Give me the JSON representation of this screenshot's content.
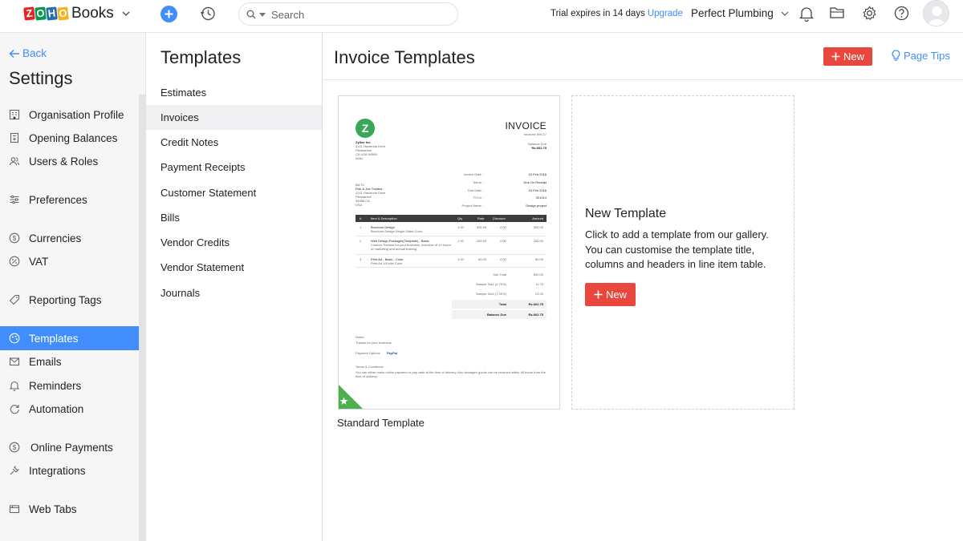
{
  "header": {
    "brand_letters": [
      "Z",
      "O",
      "H",
      "O"
    ],
    "brand_letter_colors": [
      "#e42527",
      "#089949",
      "#226db4",
      "#f9b21d"
    ],
    "brand_name": "Books",
    "search_placeholder": "Search",
    "trial_text": "Trial expires in 14 days",
    "upgrade_label": "Upgrade",
    "org_name": "Perfect Plumbing",
    "icons": [
      "add-icon",
      "history-icon",
      "search-icon",
      "bell-icon",
      "folder-icon",
      "gear-icon",
      "help-icon",
      "avatar"
    ]
  },
  "sidebar": {
    "back_label": "Back",
    "title": "Settings",
    "items": [
      {
        "label": "Organisation Profile",
        "icon": "organisation-icon"
      },
      {
        "label": "Opening Balances",
        "icon": "balances-icon"
      },
      {
        "label": "Users & Roles",
        "icon": "users-icon"
      },
      {
        "label": "Preferences",
        "icon": "preferences-icon"
      },
      {
        "label": "Currencies",
        "icon": "currency-icon"
      },
      {
        "label": "VAT",
        "icon": "percent-icon"
      },
      {
        "label": "Reporting Tags",
        "icon": "tag-icon"
      },
      {
        "label": "Templates",
        "icon": "templates-icon",
        "active": true
      },
      {
        "label": "Emails",
        "icon": "email-icon"
      },
      {
        "label": "Reminders",
        "icon": "bell-icon"
      },
      {
        "label": "Automation",
        "icon": "automation-icon"
      },
      {
        "label": "Online Payments",
        "icon": "payments-icon"
      },
      {
        "label": "Integrations",
        "icon": "integrations-icon"
      },
      {
        "label": "Web Tabs",
        "icon": "web-tabs-icon"
      }
    ]
  },
  "templates_menu": {
    "title": "Templates",
    "items": [
      {
        "label": "Estimates"
      },
      {
        "label": "Invoices",
        "active": true
      },
      {
        "label": "Credit Notes"
      },
      {
        "label": "Payment Receipts"
      },
      {
        "label": "Customer Statement"
      },
      {
        "label": "Bills"
      },
      {
        "label": "Vendor Credits"
      },
      {
        "label": "Vendor Statement"
      },
      {
        "label": "Journals"
      }
    ]
  },
  "main": {
    "title": "Invoice Templates",
    "new_label": "New",
    "page_tips_label": "Page Tips",
    "accent_color": "#408dfb",
    "danger_color": "#e9473e",
    "standard_template": {
      "label": "Standard Template",
      "preview": {
        "doc_title": "INVOICE",
        "invoice_no": "Invoice# INV-17",
        "balance_due_label": "Balance Due",
        "balance_due_value": "Rs.662.75",
        "company_lines": [
          "Zylker Inc",
          "4141 Hacienda Drive",
          "Pleasanton",
          "CA USA 94588",
          "India"
        ],
        "meta": [
          {
            "k": "Invoice Date :",
            "v": "15 Feb 2016"
          },
          {
            "k": "Terms :",
            "v": "Due On Receipt"
          },
          {
            "k": "Due Date :",
            "v": "15 Feb 2016"
          },
          {
            "k": "P.O.# :",
            "v": "321014"
          },
          {
            "k": "Project Name :",
            "v": "Design project"
          }
        ],
        "bill_to": [
          "Bill To",
          "Rob & Joe Traders",
          "4141 Hacienda Drive",
          "Pleasanton",
          "94588 CA",
          "USA"
        ],
        "columns": [
          "#",
          "Item & Description",
          "Qty",
          "Rate",
          "Discount",
          "Amount"
        ],
        "rows": [
          {
            "n": "1",
            "item": "Brochure Design",
            "desc": "Brochure Design Single Sided Color",
            "qty": "1.00",
            "rate": "300.00",
            "disc": "0.00",
            "amt": "300.00"
          },
          {
            "n": "2",
            "item": "Web Design Packages(Template) - Basic",
            "desc": "Custom Themes for your business. Inclusive of 10 hours of marketing and annual training",
            "qty": "1.00",
            "rate": "250.00",
            "disc": "0.00",
            "amt": "250.00"
          },
          {
            "n": "3",
            "item": "Print Ad - Basic - Color",
            "desc": "Print Ad 1/8 size Color",
            "qty": "1.00",
            "rate": "80.00",
            "disc": "0.00",
            "amt": "80.00"
          }
        ],
        "totals": [
          {
            "k": "Sub Total",
            "v": "630.00"
          },
          {
            "k": "Sample Tax1 (4.70%)",
            "v": "11.75"
          },
          {
            "k": "Sample Tax2 (7.00%)",
            "v": "21.00"
          },
          {
            "k": "Total",
            "v": "Rs.662.75"
          },
          {
            "k": "Balance Due",
            "v": "Rs.662.75"
          }
        ],
        "notes_label": "Notes",
        "notes_text": "Thanks for your business.",
        "payment_label": "Payment Options",
        "payment_brand": "PayPal",
        "terms_label": "Terms & Conditions",
        "terms_text": "You can either make online payment or pay cash at the time of delivery. Any damaged goods can be returned within 48 hours from the time of delivery."
      }
    },
    "new_card": {
      "title": "New Template",
      "description": "Click to add a template from our gallery. You can customise the template title, columns and headers in line item table.",
      "button_label": "New"
    }
  }
}
